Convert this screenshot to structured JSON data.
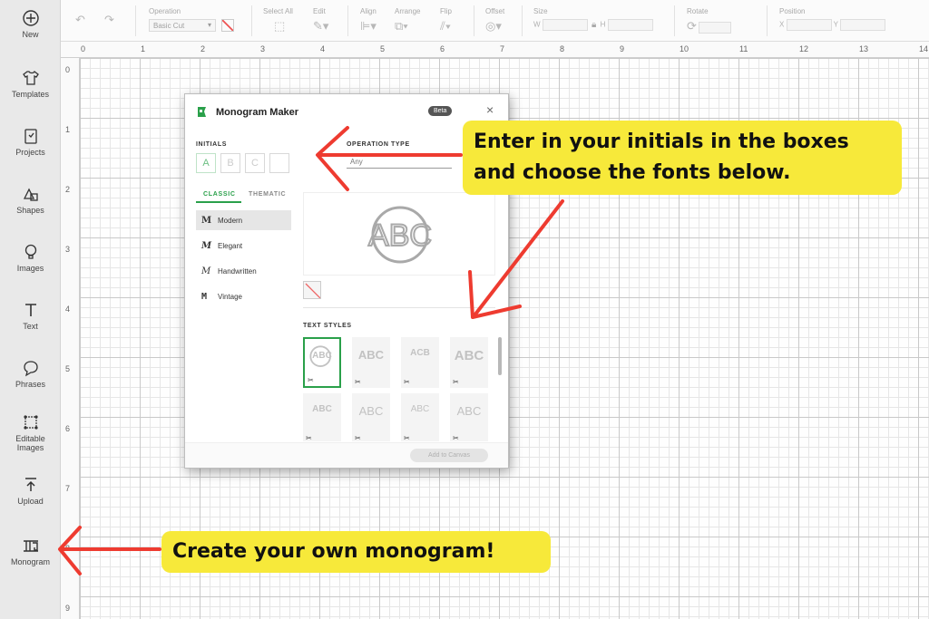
{
  "sidebar": {
    "items": [
      {
        "label": "New",
        "icon": "plus-circle-icon"
      },
      {
        "label": "Templates",
        "icon": "shirt-icon"
      },
      {
        "label": "Projects",
        "icon": "projects-icon"
      },
      {
        "label": "Shapes",
        "icon": "shapes-icon"
      },
      {
        "label": "Images",
        "icon": "lightbulb-icon"
      },
      {
        "label": "Text",
        "icon": "text-icon"
      },
      {
        "label": "Phrases",
        "icon": "speech-bubble-icon"
      },
      {
        "label": "Editable",
        "label2": "Images",
        "icon": "editable-images-icon"
      },
      {
        "label": "Upload",
        "icon": "upload-icon"
      },
      {
        "label": "Monogram",
        "icon": "monogram-icon"
      }
    ]
  },
  "toolbar": {
    "operation_label": "Operation",
    "operation_value": "Basic Cut",
    "select_all_label": "Select All",
    "edit_label": "Edit",
    "align_label": "Align",
    "arrange_label": "Arrange",
    "flip_label": "Flip",
    "offset_label": "Offset",
    "size_label": "Size",
    "w_label": "W",
    "h_label": "H",
    "rotate_label": "Rotate",
    "position_label": "Position",
    "x_label": "X",
    "y_label": "Y"
  },
  "ruler": {
    "top": [
      "0",
      "1",
      "2",
      "3",
      "4",
      "5",
      "6",
      "7",
      "8",
      "9",
      "10",
      "11",
      "12",
      "13",
      "14"
    ],
    "left": [
      "0",
      "1",
      "2",
      "3",
      "4",
      "5",
      "6",
      "7",
      "8",
      "9"
    ]
  },
  "dialog": {
    "title": "Monogram Maker",
    "badge": "Beta",
    "close": "×",
    "initials_label": "INITIALS",
    "initials": [
      "A",
      "B",
      "C",
      ""
    ],
    "operation_type_label": "OPERATION TYPE",
    "operation_type_value": "Any",
    "tabs": [
      "CLASSIC",
      "THEMATIC"
    ],
    "fonts": [
      {
        "label": "Modern",
        "glyph": "M"
      },
      {
        "label": "Elegant",
        "glyph": "M"
      },
      {
        "label": "Handwritten",
        "glyph": "M"
      },
      {
        "label": "Vintage",
        "glyph": "M"
      }
    ],
    "preview_text": "ABC",
    "text_styles_label": "TEXT STYLES",
    "text_styles": [
      "ABC",
      "ABC",
      "ACB",
      "ABC",
      "ABC",
      "ABC",
      "ABC",
      "ABC"
    ],
    "add_button": "Add to Canvas"
  },
  "callouts": {
    "top_line1": "Enter in your initials in the boxes",
    "top_line2": "and choose the fonts below.",
    "bottom": "Create your own monogram!"
  },
  "colors": {
    "callout_bg": "#f7e93a",
    "arrow": "#ee3b30",
    "accent_green": "#2aa04a"
  }
}
